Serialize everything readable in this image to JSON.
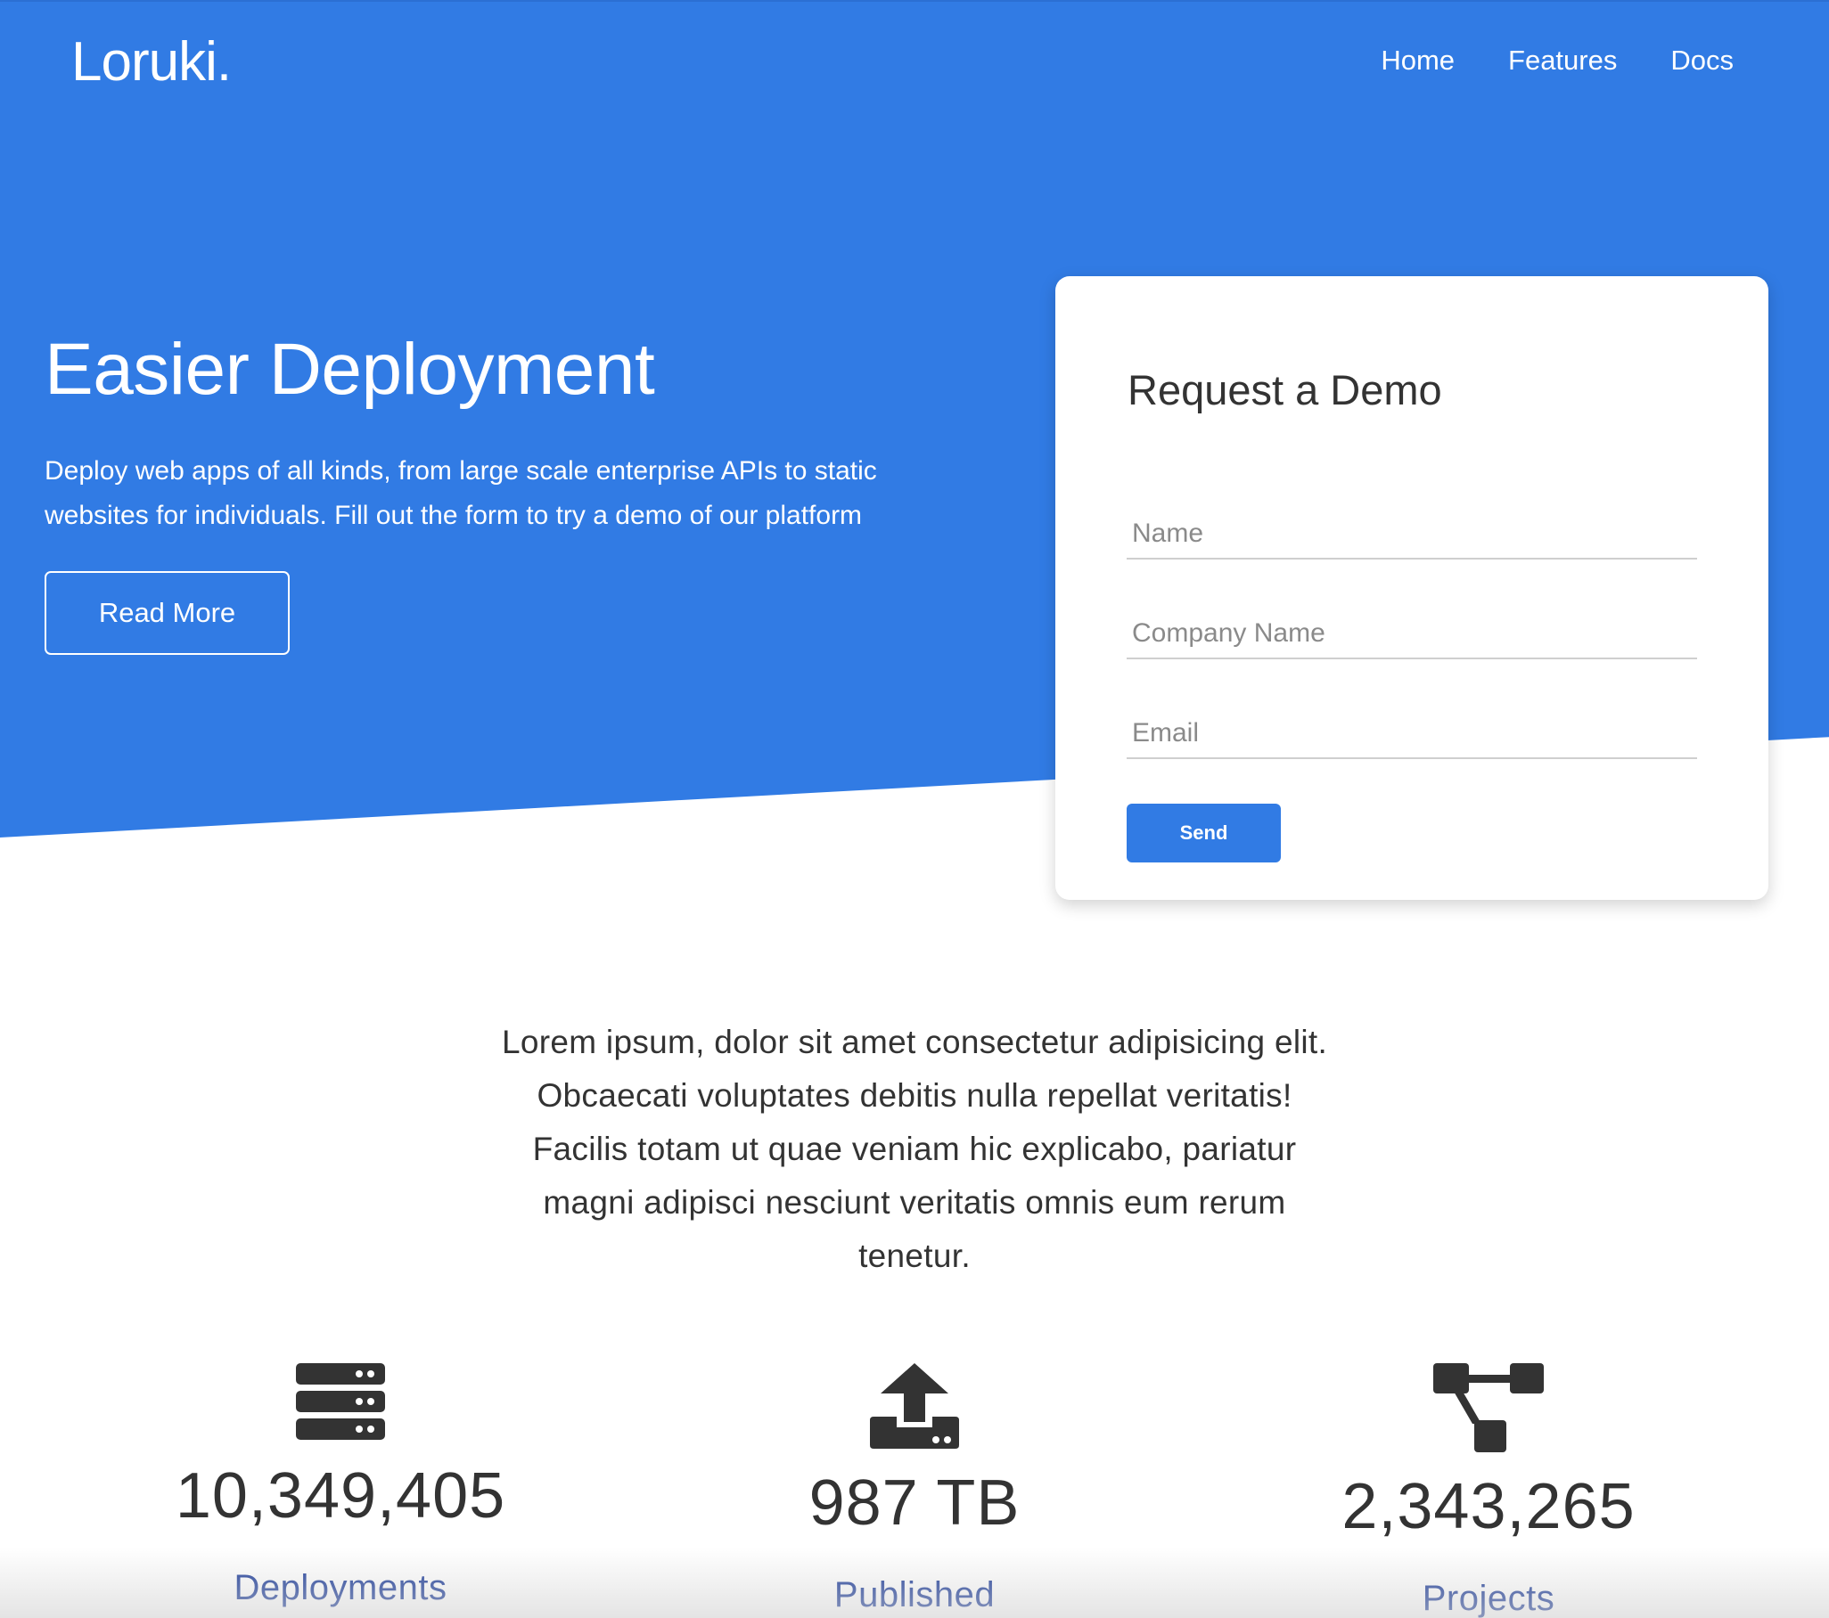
{
  "brand": {
    "logo_text": "Loruki."
  },
  "nav": {
    "items": [
      {
        "label": "Home"
      },
      {
        "label": "Features"
      },
      {
        "label": "Docs"
      }
    ]
  },
  "hero": {
    "title": "Easier Deployment",
    "text": "Deploy web apps of all kinds, from large scale enterprise APIs to static websites for individuals. Fill out the form to try a demo of our platform",
    "button_label": "Read More"
  },
  "demo_form": {
    "title": "Request a Demo",
    "fields": [
      {
        "placeholder": "Name",
        "value": ""
      },
      {
        "placeholder": "Company Name",
        "value": ""
      },
      {
        "placeholder": "Email",
        "value": ""
      }
    ],
    "submit_label": "Send"
  },
  "intro": {
    "text": "Lorem ipsum, dolor sit amet consectetur adipisicing elit. Obcaecati voluptates debitis nulla repellat veritatis! Facilis totam ut quae veniam hic explicabo, pariatur magni adipisci nesciunt veritatis omnis eum rerum tenetur."
  },
  "stats": [
    {
      "icon": "server-icon",
      "value": "10,349,405",
      "label": "Deployments"
    },
    {
      "icon": "upload-icon",
      "value": "987 TB",
      "label": "Published"
    },
    {
      "icon": "project-diagram-icon",
      "value": "2,343,265",
      "label": "Projects"
    }
  ],
  "colors": {
    "primary": "#317be4",
    "text": "#333333",
    "stat_label": "#1f3e9a"
  }
}
